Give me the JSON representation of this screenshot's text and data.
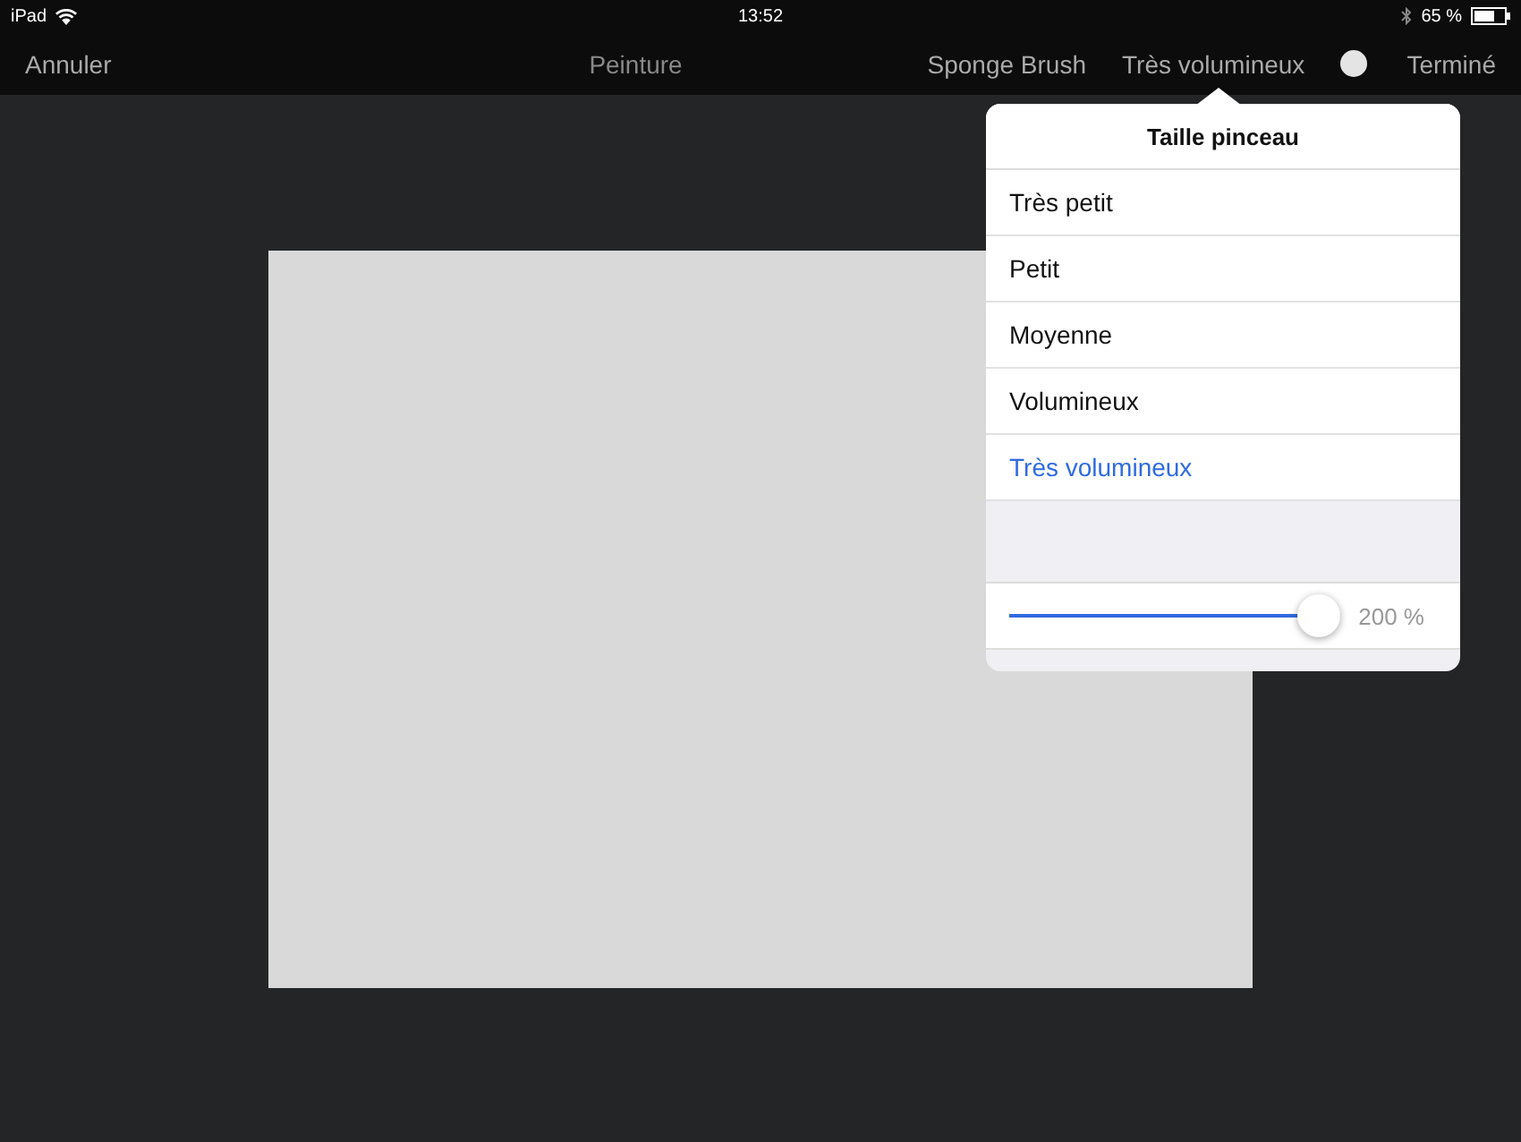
{
  "status_bar": {
    "device": "iPad",
    "time": "13:52",
    "battery": "65 %"
  },
  "nav_bar": {
    "cancel": "Annuler",
    "title": "Peinture",
    "brush": "Sponge Brush",
    "size": "Très volumineux",
    "done": "Terminé"
  },
  "popover": {
    "title": "Taille pinceau",
    "options": [
      {
        "label": "Très petit",
        "selected": false
      },
      {
        "label": "Petit",
        "selected": false
      },
      {
        "label": "Moyenne",
        "selected": false
      },
      {
        "label": "Volumineux",
        "selected": false
      },
      {
        "label": "Très volumineux",
        "selected": true
      }
    ],
    "slider": {
      "level": 1,
      "reading": "200 %"
    }
  }
}
